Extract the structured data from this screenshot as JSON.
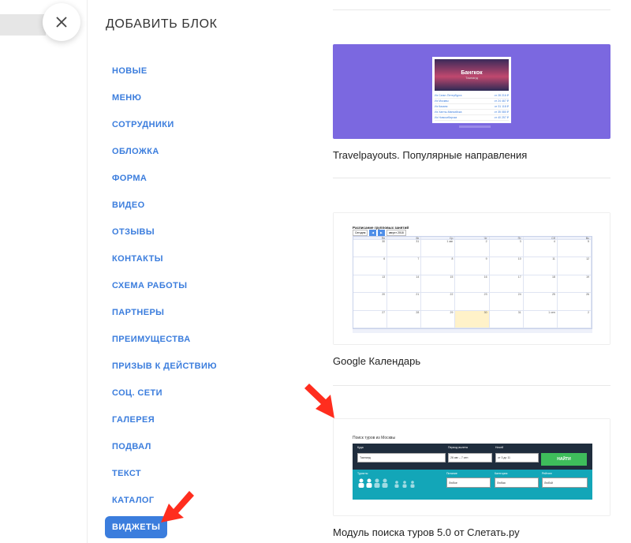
{
  "panel": {
    "title": "ДОБАВИТЬ БЛОК",
    "categories": [
      {
        "label": "НОВЫЕ",
        "active": false
      },
      {
        "label": "МЕНЮ",
        "active": false
      },
      {
        "label": "СОТРУДНИКИ",
        "active": false
      },
      {
        "label": "ОБЛОЖКА",
        "active": false
      },
      {
        "label": "ФОРМА",
        "active": false
      },
      {
        "label": "ВИДЕО",
        "active": false
      },
      {
        "label": "ОТЗЫВЫ",
        "active": false
      },
      {
        "label": "КОНТАКТЫ",
        "active": false
      },
      {
        "label": "СХЕМА РАБОТЫ",
        "active": false
      },
      {
        "label": "ПАРТНЕРЫ",
        "active": false
      },
      {
        "label": "ПРЕИМУЩЕСТВА",
        "active": false
      },
      {
        "label": "ПРИЗЫВ К ДЕЙСТВИЮ",
        "active": false
      },
      {
        "label": "СОЦ. СЕТИ",
        "active": false
      },
      {
        "label": "ГАЛЕРЕЯ",
        "active": false
      },
      {
        "label": "ПОДВАЛ",
        "active": false
      },
      {
        "label": "ТЕКСТ",
        "active": false
      },
      {
        "label": "КАТАЛОГ",
        "active": false
      },
      {
        "label": "ВИДЖЕТЫ",
        "active": true
      }
    ]
  },
  "close": {
    "icon": "close-icon"
  },
  "blocks": [
    {
      "title": "Travelpayouts. Популярные направления",
      "preview": {
        "city": "Бангкок",
        "subtitle": "Таиланд",
        "rows": [
          {
            "name": "Из Санкт-Петербурга",
            "price": "от 28 216 ₽"
          },
          {
            "name": "Из Москвы",
            "price": "от 24 467 ₽"
          },
          {
            "name": "Из Казани",
            "price": "от 31 118 ₽"
          },
          {
            "name": "Из Ханты-Мансийска",
            "price": "от 35 080 ₽"
          },
          {
            "name": "Из Новосибирска",
            "price": "от 40 257 ₽"
          }
        ]
      }
    },
    {
      "title": "Google Календарь",
      "preview": {
        "heading": "Расписание групповых занятий",
        "today_btn": "Сегодня",
        "month": "август 2018",
        "days": [
          "Пн",
          "Вт",
          "Ср",
          "Чт",
          "Пт",
          "Сб",
          "Вс"
        ],
        "weeks": [
          [
            "30",
            "31",
            "1 авг",
            "2",
            "3",
            "4",
            "5"
          ],
          [
            "6",
            "7",
            "8",
            "9",
            "10",
            "11",
            "12"
          ],
          [
            "13",
            "14",
            "15",
            "16",
            "17",
            "18",
            "19"
          ],
          [
            "20",
            "21",
            "22",
            "23",
            "24",
            "25",
            "26"
          ],
          [
            "27",
            "28",
            "29",
            "30",
            "31",
            "1 сен",
            "2"
          ]
        ]
      }
    },
    {
      "title": "Модуль поиска туров 5.0 от Слетать.ру",
      "preview": {
        "label": "Поиск туров из Москвы",
        "where": "Куда",
        "where_value": "Таиланд",
        "period": "Период вылета",
        "period_value": "26 авг – 7 сен",
        "nights": "Ночей",
        "nights_value": "от 3 до 11",
        "search_btn": "НАЙТИ",
        "tourists": "Туристы",
        "food": "Питание",
        "food_value": "Любое",
        "category": "Категория",
        "category_value": "Любая",
        "rating": "Рейтинг",
        "rating_value": "Любой"
      }
    }
  ],
  "colors": {
    "accent": "#3b7ddd",
    "travelpayouts_bg": "#7b68e0",
    "annotation_arrow": "#ff2d1e",
    "sletat_dark": "#1f2d3d",
    "sletat_teal": "#13a6b8",
    "sletat_green": "#3ebd5b"
  }
}
